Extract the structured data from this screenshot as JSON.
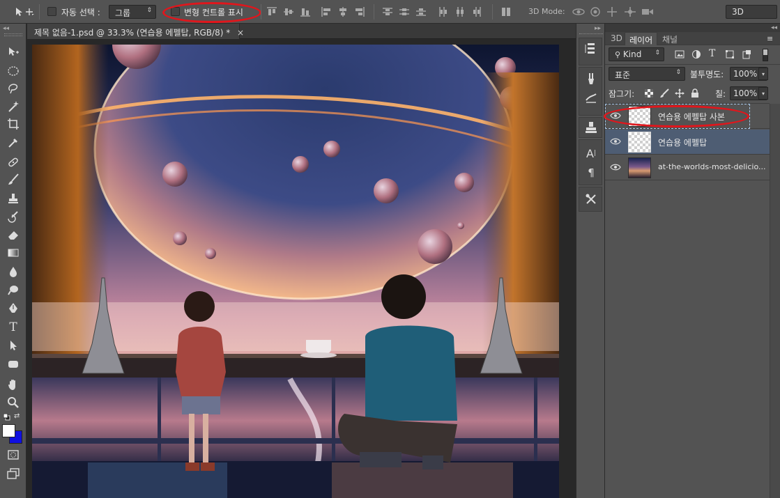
{
  "options_bar": {
    "move_tool_icon": "move-icon",
    "auto_select_label": "자동 선택 :",
    "auto_select_checked": false,
    "auto_select_target": "그룹",
    "show_transform_label": "변형 컨트롤 표시",
    "show_transform_checked": false,
    "mode_3d_label": "3D Mode:",
    "workspace_value": "3D"
  },
  "document": {
    "tab_title": "제목 없음-1.psd @ 33.3% (연습용 에펠탑, RGB/8) *",
    "close_symbol": "×"
  },
  "layers_panel": {
    "tabs": [
      {
        "label": "3D",
        "active": false
      },
      {
        "label": "레이어",
        "active": true
      },
      {
        "label": "채널",
        "active": false
      }
    ],
    "filter_kind": "Kind",
    "blend_mode": "표준",
    "opacity_label": "불투명도:",
    "opacity_value": "100%",
    "lock_label": "잠그기:",
    "fill_label": "칠:",
    "fill_value": "100%",
    "layers": [
      {
        "name": "연습용 에펠탑 사본",
        "visible": true,
        "selected": true,
        "thumb": "transparent"
      },
      {
        "name": "연습용 에펠탑",
        "visible": true,
        "selected": false,
        "thumb": "transparent"
      },
      {
        "name": "at-the-worlds-most-delicio...",
        "visible": true,
        "selected": false,
        "thumb": "image"
      }
    ]
  },
  "colors": {
    "foreground": "#ffffff",
    "background": "#1010e0",
    "highlight_circle": "#e0161c",
    "selected_layer": "#4e5d73"
  },
  "tools": [
    "move-icon",
    "marquee-icon",
    "lasso-icon",
    "magic-wand-icon",
    "crop-icon",
    "eyedropper-icon",
    "healing-brush-icon",
    "brush-icon",
    "clone-stamp-icon",
    "history-brush-icon",
    "eraser-icon",
    "gradient-icon",
    "blur-icon",
    "dodge-icon",
    "pen-icon",
    "type-icon",
    "path-selection-icon",
    "shape-icon",
    "hand-icon",
    "zoom-icon"
  ]
}
